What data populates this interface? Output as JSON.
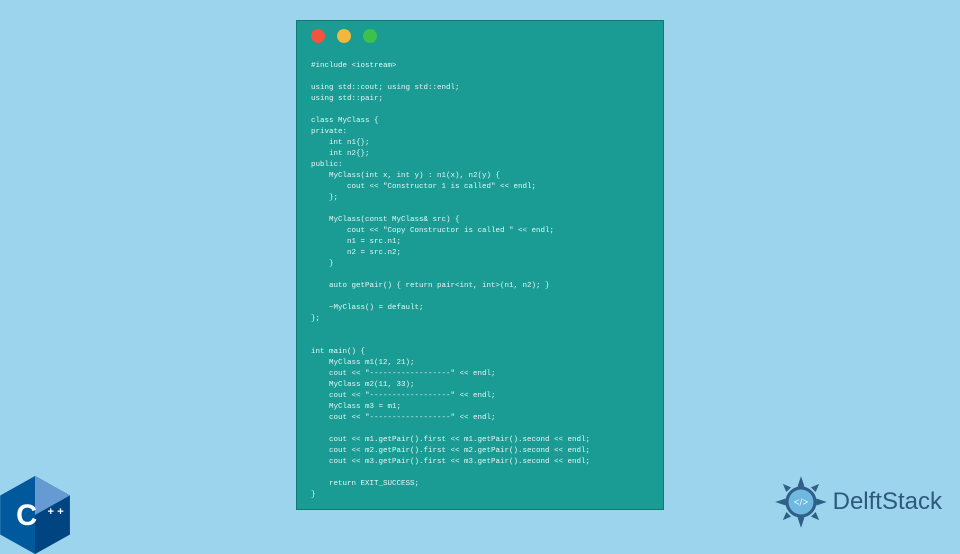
{
  "code": "#include <iostream>\n\nusing std::cout; using std::endl;\nusing std::pair;\n\nclass MyClass {\nprivate:\n    int n1{};\n    int n2{};\npublic:\n    MyClass(int x, int y) : n1(x), n2(y) {\n        cout << \"Constructor 1 is called\" << endl;\n    };\n\n    MyClass(const MyClass& src) {\n        cout << \"Copy Constructor is called \" << endl;\n        n1 = src.n1;\n        n2 = src.n2;\n    }\n\n    auto getPair() { return pair<int, int>(n1, n2); }\n\n    ~MyClass() = default;\n};\n\n\nint main() {\n    MyClass m1(12, 21);\n    cout << \"------------------\" << endl;\n    MyClass m2(11, 33);\n    cout << \"------------------\" << endl;\n    MyClass m3 = m1;\n    cout << \"------------------\" << endl;\n\n    cout << m1.getPair().first << m1.getPair().second << endl;\n    cout << m2.getPair().first << m2.getPair().second << endl;\n    cout << m3.getPair().first << m3.getPair().second << endl;\n\n    return EXIT_SUCCESS;\n}",
  "brand": {
    "text": "DelftStack"
  },
  "cpp_badge": {
    "label": "C++"
  },
  "dots": {
    "red": "#f2543d",
    "yellow": "#f3b73e",
    "green": "#3cc14a"
  }
}
